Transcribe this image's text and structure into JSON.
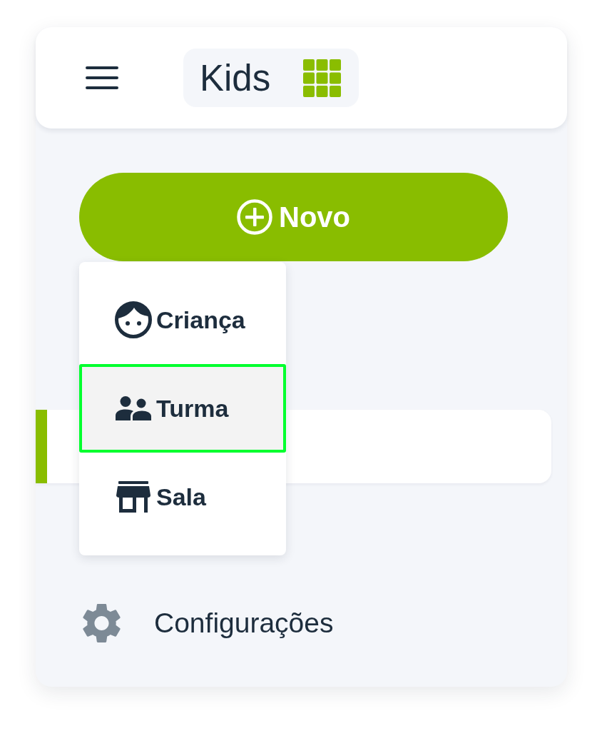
{
  "header": {
    "app_name": "Kids"
  },
  "new_button": {
    "label": "Novo"
  },
  "new_menu": {
    "items": [
      {
        "kind": "child",
        "label": "Criança",
        "selected": false
      },
      {
        "kind": "group",
        "label": "Turma",
        "selected": true
      },
      {
        "kind": "room",
        "label": "Sala",
        "selected": false
      }
    ]
  },
  "sidebar": {
    "items": [
      {
        "selected": true
      }
    ],
    "footer": {
      "label": "Configurações"
    }
  }
}
